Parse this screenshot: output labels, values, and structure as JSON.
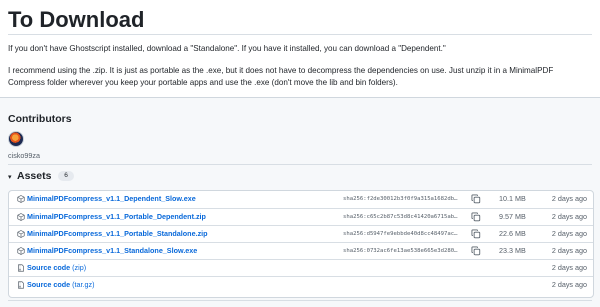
{
  "release": {
    "heading": "To Download",
    "paragraphs": [
      "If you don't have Ghostscript installed, download a \"Standalone\". If you have it installed, you can download a \"Dependent.\"",
      "I recommend using the .zip. It is just as portable as the .exe, but it does not have to decompress the dependencies on use. Just unzip it in a MinimalPDF Compress folder wherever you keep your portable apps and use the .exe (don't move the lib and bin folders)."
    ]
  },
  "contributors": {
    "title": "Contributors",
    "users": [
      {
        "name": "cisko99za",
        "avatar_icon": "user-avatar"
      }
    ]
  },
  "assets": {
    "title": "Assets",
    "count": "6",
    "rows": [
      {
        "name": "MinimalPDFcompress_v1.1_Dependent_Slow.exe",
        "sha": "sha256:f2de30012b3f0f9a315a1682db…",
        "size": "10.1 MB",
        "date": "2 days ago",
        "icon": "package-icon"
      },
      {
        "name": "MinimalPDFcompress_v1.1_Portable_Dependent.zip",
        "sha": "sha256:c65c2b87c53d8c41420a6715ab…",
        "size": "9.57 MB",
        "date": "2 days ago",
        "icon": "package-icon"
      },
      {
        "name": "MinimalPDFcompress_v1.1_Portable_Standalone.zip",
        "sha": "sha256:d5947fe9ebbde40d8cc48497ac…",
        "size": "22.6 MB",
        "date": "2 days ago",
        "icon": "package-icon"
      },
      {
        "name": "MinimalPDFcompress_v1.1_Standalone_Slow.exe",
        "sha": "sha256:0732ac6fe13ae538e665e3d280…",
        "size": "23.3 MB",
        "date": "2 days ago",
        "icon": "package-icon"
      }
    ],
    "sources": [
      {
        "label": "Source code",
        "suffix": "(zip)",
        "date": "2 days ago",
        "icon": "file-zip-icon"
      },
      {
        "label": "Source code",
        "suffix": "(tar.gz)",
        "date": "2 days ago",
        "icon": "file-zip-icon"
      }
    ]
  },
  "colors": {
    "link": "#0969da",
    "muted": "#57606a",
    "border": "#d0d7de",
    "page_bg": "#f6f8fa"
  }
}
